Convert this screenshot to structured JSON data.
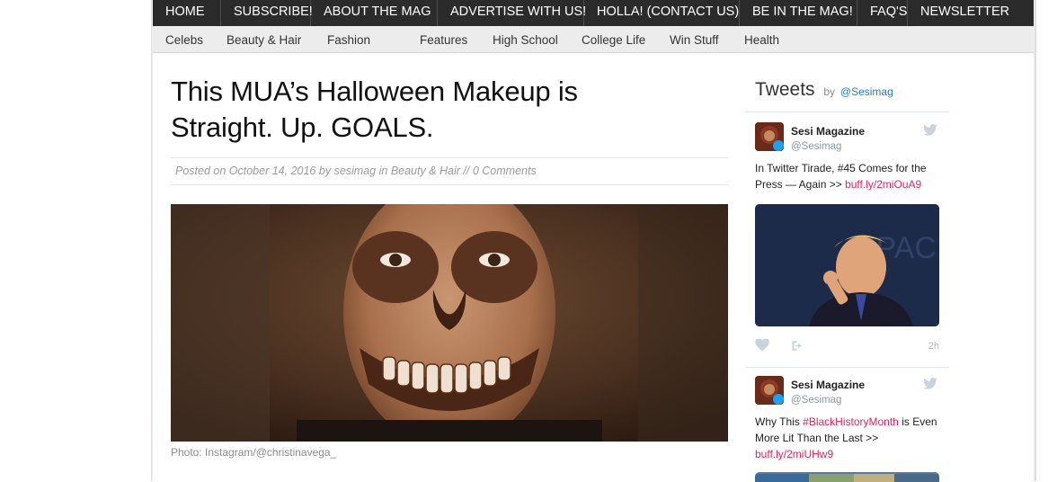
{
  "top_nav": [
    {
      "label": "HOME"
    },
    {
      "label": "SUBSCRIBE!"
    },
    {
      "label": "ABOUT THE MAG"
    },
    {
      "label": "ADVERTISE WITH US!"
    },
    {
      "label": "HOLLA! (CONTACT US)"
    },
    {
      "label": "BE IN THE MAG!"
    },
    {
      "label": "FAQ'S"
    },
    {
      "label": "NEWSLETTER"
    }
  ],
  "sub_nav": [
    {
      "label": "Celebs"
    },
    {
      "label": "Beauty & Hair"
    },
    {
      "label": "Fashion"
    },
    {
      "label": "Features"
    },
    {
      "label": "High School"
    },
    {
      "label": "College Life"
    },
    {
      "label": "Win Stuff"
    },
    {
      "label": "Health"
    }
  ],
  "article": {
    "title_line1": "This MUA’s Halloween Makeup is",
    "title_line2": "Straight. Up. GOALS.",
    "meta": {
      "posted_on": "Posted on",
      "date": "October 14, 2016",
      "by": "by",
      "author": "sesimag",
      "in": "in",
      "category": "Beauty & Hair",
      "sep": "//",
      "comments": "0 Comments"
    },
    "caption": "Photo: Instagram/@christinavega_"
  },
  "sidebar": {
    "heading": "Tweets",
    "by": "by",
    "handle": "@Sesimag",
    "tweets": [
      {
        "name": "Sesi Magazine",
        "handle": "@Sesimag",
        "text_before": "In Twitter Tirade, #45 Comes for the Press — Again >>",
        "link": "buff.ly/2miOuA9",
        "time": "2h"
      },
      {
        "name": "Sesi Magazine",
        "handle": "@Sesimag",
        "text_before": "Why This",
        "hashtag": "#BlackHistoryMonth",
        "text_after": "is Even More Lit Than the Last >>",
        "link": "buff.ly/2miUHw9"
      }
    ]
  },
  "colors": {
    "nav_bg": "#2b2b2b",
    "subnav_bg": "#ececec",
    "link_red": "#e0245e",
    "handle_blue": "#2b7bb9"
  }
}
